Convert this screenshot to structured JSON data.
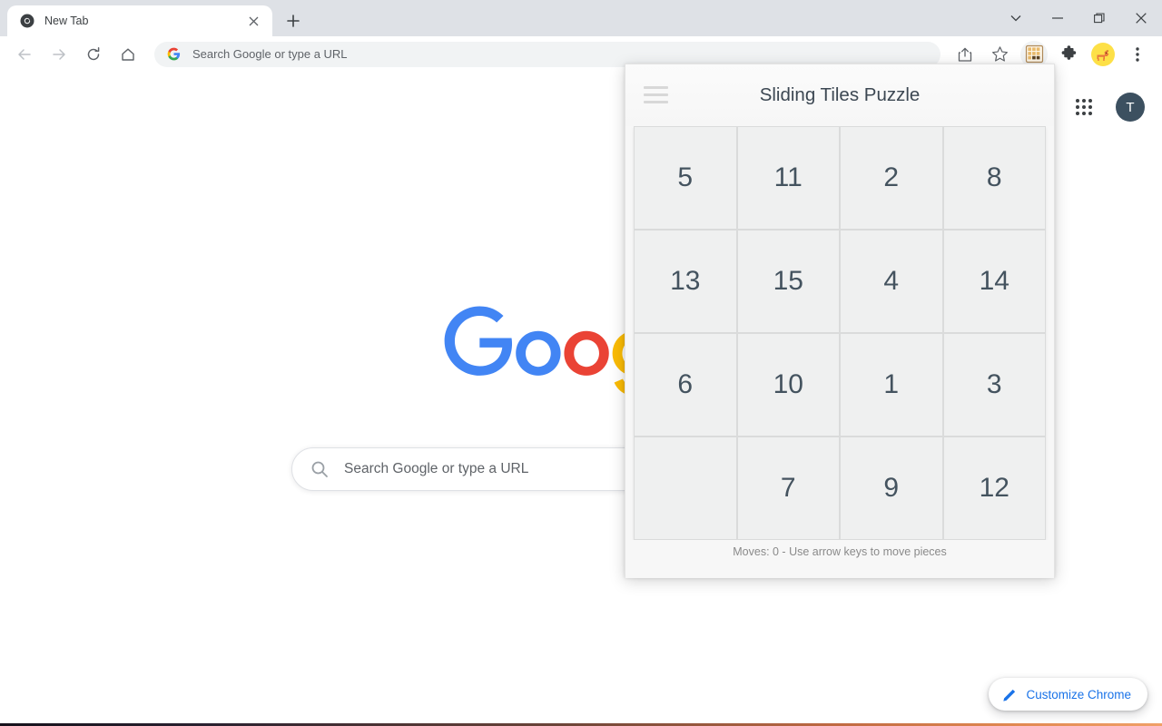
{
  "browser": {
    "tab": {
      "title": "New Tab",
      "favicon": "chrome-favicon-icon",
      "close": "×"
    },
    "new_tab_button": "+",
    "window_controls": {
      "tab_search": "tab-search-chevron-icon",
      "minimize": "minimize-icon",
      "maximize": "maximize-icon",
      "close": "close-icon"
    },
    "nav": {
      "back": "back-arrow-icon",
      "forward": "forward-arrow-icon",
      "reload": "reload-icon",
      "home": "home-icon"
    },
    "omnibox": {
      "placeholder": "Search Google or type a URL",
      "value": "",
      "leading_icon": "google-g-icon"
    },
    "toolbar_actions": {
      "share": "share-icon",
      "bookmark": "star-icon",
      "puzzle_extension": "sliding-tiles-extension-icon",
      "extensions": "puzzle-piece-icon",
      "profile": "dog-avatar-icon",
      "menu": "three-dot-menu-icon"
    }
  },
  "newtab_page": {
    "apps_button": "google-apps-grid-icon",
    "account_avatar_letter": "T",
    "logo": "google-logo",
    "search_box": {
      "placeholder": "Search Google or type a URL",
      "icon": "search-icon"
    },
    "customize_button": {
      "label": "Customize Chrome",
      "icon": "pencil-icon"
    }
  },
  "popup": {
    "menu_icon": "hamburger-menu-icon",
    "title": "Sliding Tiles Puzzle",
    "footer": "Moves: 0 - Use arrow keys to move pieces",
    "moves": 0,
    "grid_size": 4,
    "tiles": [
      [
        "5",
        "11",
        "2",
        "8"
      ],
      [
        "13",
        "15",
        "4",
        "14"
      ],
      [
        "6",
        "10",
        "1",
        "3"
      ],
      [
        "",
        "7",
        "9",
        "12"
      ]
    ]
  },
  "colors": {
    "tab_strip": "#dee1e6",
    "tile_face": "#eff0f0",
    "tile_text": "#44535f",
    "popup_bg": "#f7f7f7",
    "accent_blue": "#1a73e8"
  }
}
